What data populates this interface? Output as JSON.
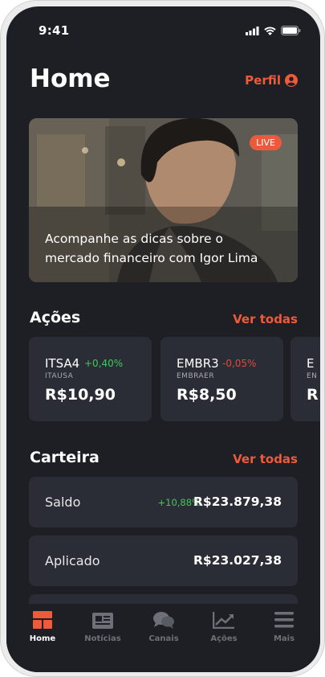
{
  "status_bar": {
    "time": "9:41"
  },
  "header": {
    "title": "Home",
    "profile_label": "Perfil"
  },
  "hero": {
    "live_badge": "LIVE",
    "caption": "Acompanhe as dicas sobre o mercado financeiro com Igor Lima"
  },
  "stocks_section": {
    "title": "Ações",
    "see_all": "Ver todas",
    "items": [
      {
        "ticker": "ITSA4",
        "change": "+0,40%",
        "name": "ITAUSA",
        "price": "R$10,90"
      },
      {
        "ticker": "EMBR3",
        "change": "-0,05%",
        "name": "EMBRAER",
        "price": "R$8,50"
      },
      {
        "ticker": "E",
        "name": "EN",
        "price": "R"
      }
    ]
  },
  "wallet_section": {
    "title": "Carteira",
    "see_all": "Ver todas",
    "rows": [
      {
        "label": "Saldo",
        "change": "+10,88%",
        "amount": "R$23.879,38"
      },
      {
        "label": "Aplicado",
        "amount": "R$23.027,38"
      }
    ]
  },
  "tabbar": {
    "tabs": [
      {
        "label": "Home",
        "icon": "home-grid-icon",
        "active": true
      },
      {
        "label": "Notícias",
        "icon": "newspaper-icon"
      },
      {
        "label": "Canais",
        "icon": "chat-bubbles-icon"
      },
      {
        "label": "Ações",
        "icon": "chart-line-icon"
      },
      {
        "label": "Mais",
        "icon": "menu-icon"
      }
    ]
  },
  "colors": {
    "accent": "#ee5a3a",
    "positive": "#42c95a",
    "negative": "#e2493a",
    "background": "#1d1f24",
    "card": "#2a2d35"
  }
}
